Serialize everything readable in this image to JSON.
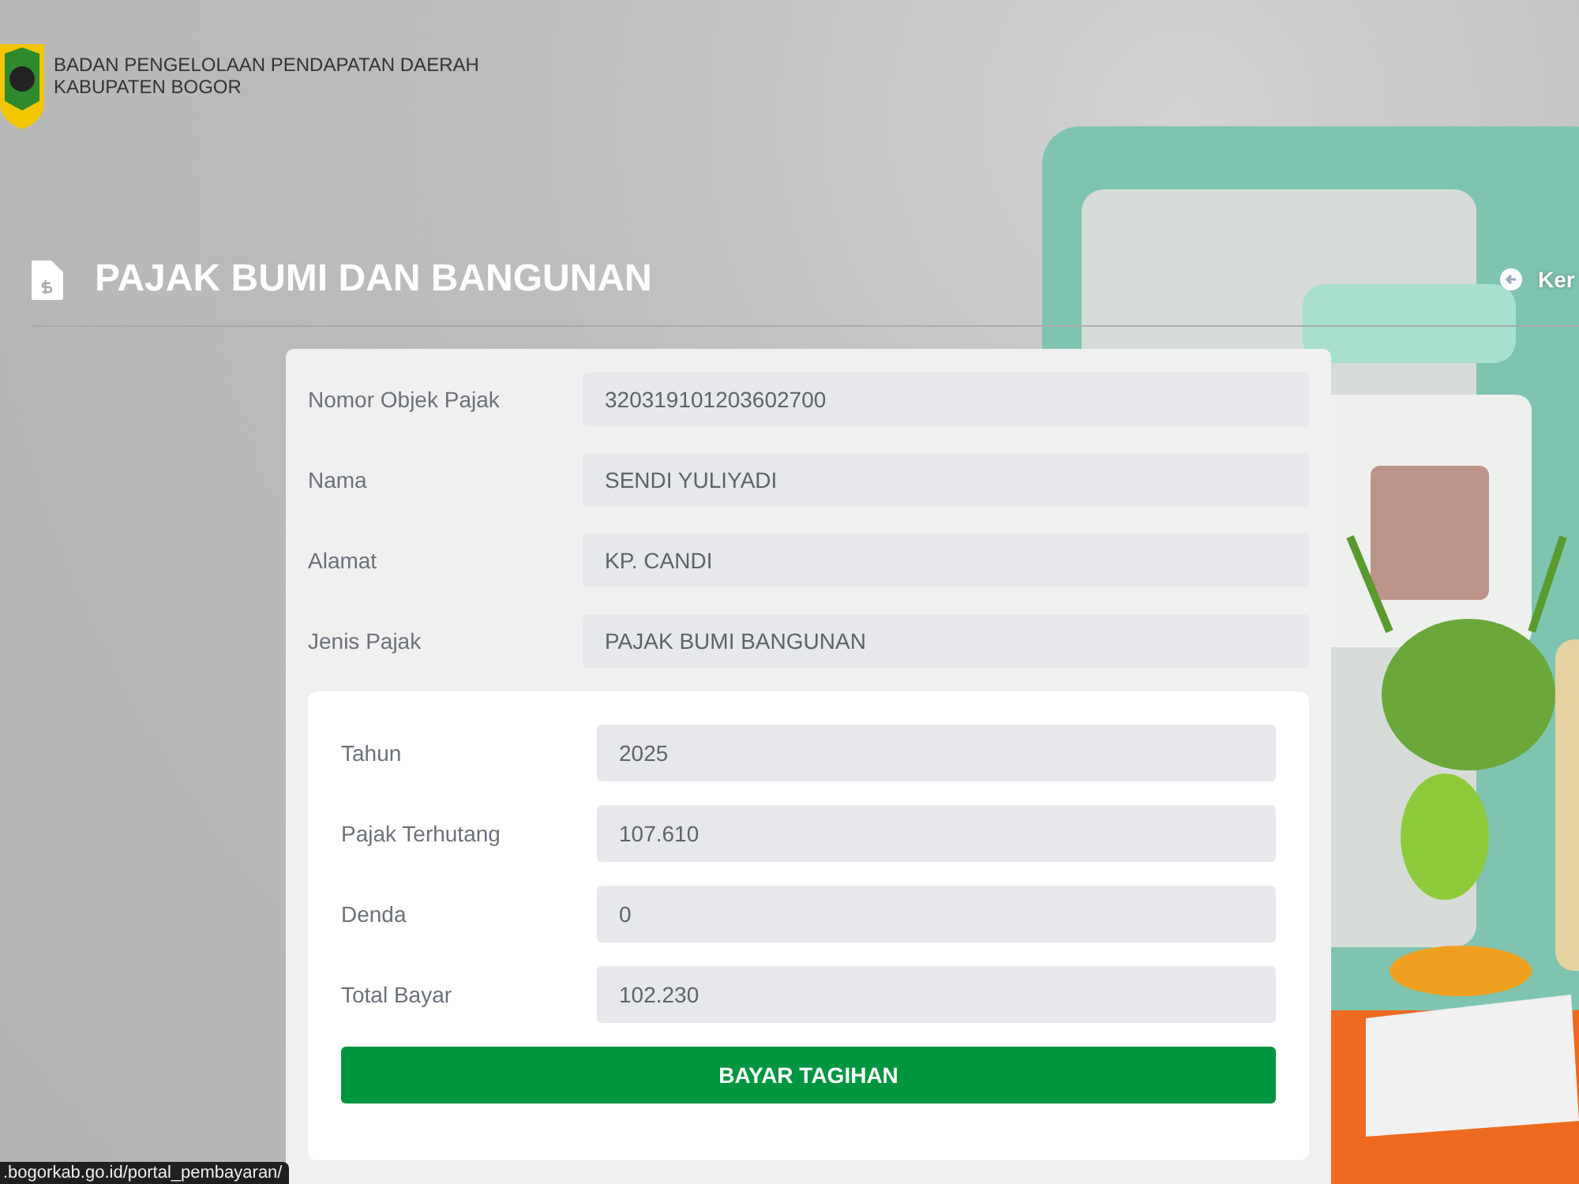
{
  "header": {
    "org_lines": [
      "BADAN PENGELOLAAN PENDAPATAN DAERAH",
      "KABUPATEN BOGOR"
    ]
  },
  "page_title": "PAJAK BUMI DAN BANGUNAN",
  "back_link": "Ker",
  "object_fields": [
    {
      "label": "Nomor Objek Pajak",
      "value": "320319101203602700"
    },
    {
      "label": "Nama",
      "value": "SENDI YULIYADI"
    },
    {
      "label": "Alamat",
      "value": "KP. CANDI"
    },
    {
      "label": "Jenis Pajak",
      "value": "PAJAK BUMI BANGUNAN"
    }
  ],
  "bill_fields": [
    {
      "label": "Tahun",
      "value": "2025"
    },
    {
      "label": "Pajak Terhutang",
      "value": "107.610"
    },
    {
      "label": "Denda",
      "value": "0"
    },
    {
      "label": "Total Bayar",
      "value": "102.230"
    }
  ],
  "pay_button": "BAYAR TAGIHAN",
  "status_bar": ".bogorkab.go.id/portal_pembayaran/"
}
